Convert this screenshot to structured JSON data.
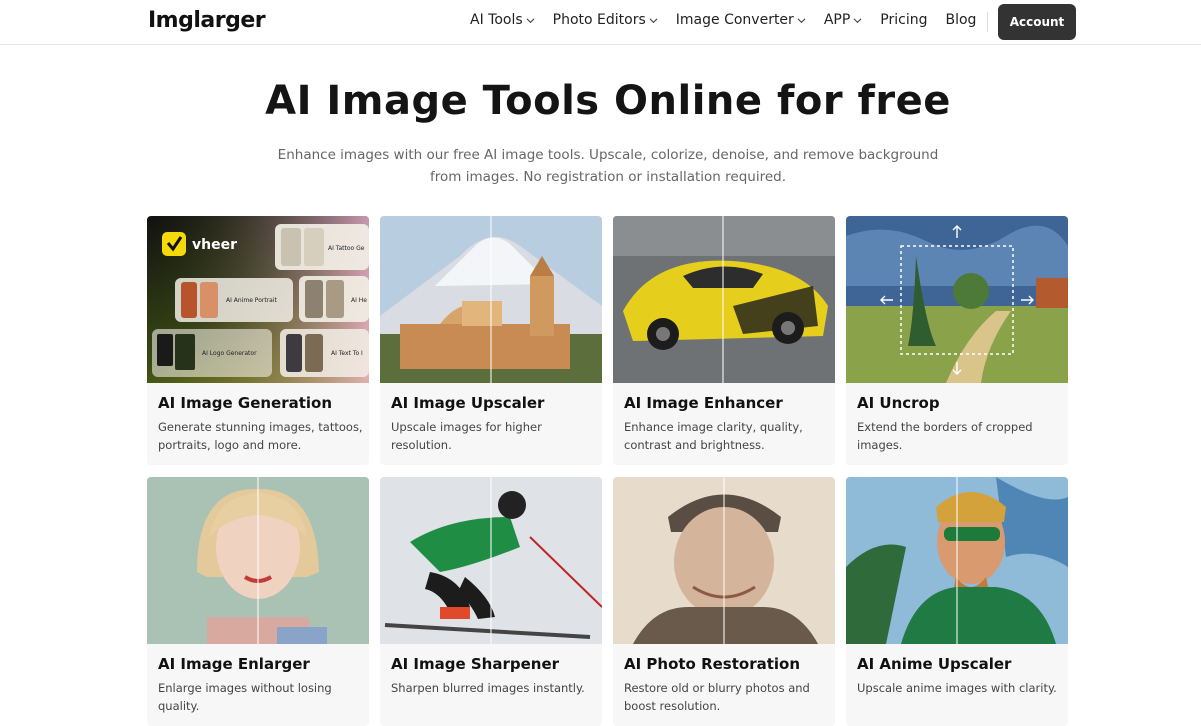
{
  "header": {
    "logo": "Imglarger",
    "nav": [
      {
        "label": "AI Tools",
        "dropdown": true
      },
      {
        "label": "Photo Editors",
        "dropdown": true
      },
      {
        "label": "Image Converter",
        "dropdown": true
      },
      {
        "label": "APP",
        "dropdown": true
      },
      {
        "label": "Pricing",
        "dropdown": false
      },
      {
        "label": "Blog",
        "dropdown": false
      }
    ],
    "account_label": "Account"
  },
  "hero": {
    "title": "AI Image Tools Online for free",
    "subtitle": "Enhance images with our free AI image tools. Upscale, colorize, denoise, and remove background from images. No registration or installation required."
  },
  "cards": [
    {
      "title": "AI Image Generation",
      "desc": "Generate stunning images, tattoos, portraits, logo and more.",
      "thumb_labels": {
        "brand": "vheer",
        "t1": "AI Tattoo Ge",
        "t2": "AI Anime Portrait",
        "t3": "AI He",
        "t4": "AI Logo Generator",
        "t5": "AI Text To I"
      }
    },
    {
      "title": "AI Image Upscaler",
      "desc": "Upscale images for higher resolution."
    },
    {
      "title": "AI Image Enhancer",
      "desc": "Enhance image clarity, quality, contrast and brightness."
    },
    {
      "title": "AI Uncrop",
      "desc": "Extend the borders of cropped images."
    },
    {
      "title": "AI Image Enlarger",
      "desc": "Enlarge images without losing quality."
    },
    {
      "title": "AI Image Sharpener",
      "desc": "Sharpen blurred images instantly."
    },
    {
      "title": "AI Photo Restoration",
      "desc": "Restore old or blurry photos and boost resolution."
    },
    {
      "title": "AI Anime Upscaler",
      "desc": "Upscale anime images with clarity."
    }
  ],
  "colors": {
    "accent_button": "#333333",
    "card_bg": "#f7f7f8"
  }
}
